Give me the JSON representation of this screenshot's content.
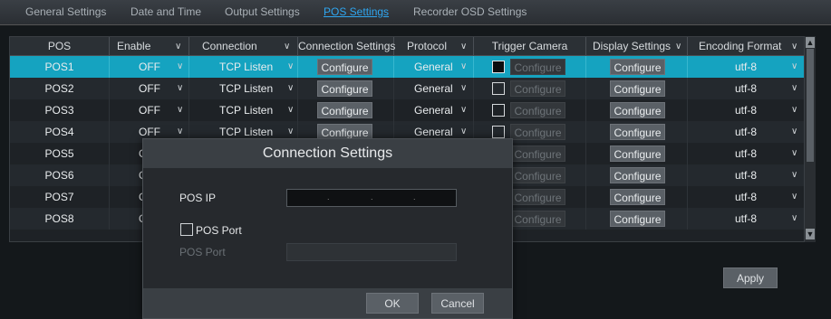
{
  "tabs": [
    {
      "label": "General Settings",
      "active": false
    },
    {
      "label": "Date and Time",
      "active": false
    },
    {
      "label": "Output Settings",
      "active": false
    },
    {
      "label": "POS Settings",
      "active": true
    },
    {
      "label": "Recorder OSD Settings",
      "active": false
    }
  ],
  "table": {
    "headers": [
      "POS",
      "Enable",
      "Connection",
      "Connection Settings",
      "Protocol",
      "Trigger Camera",
      "Display Settings",
      "Encoding Format"
    ],
    "rows": [
      {
        "pos": "POS1",
        "enable": "OFF",
        "connection": "TCP Listen",
        "conn_settings": "Configure",
        "protocol": "General",
        "trigger_checked": true,
        "trigger_btn": "Configure",
        "display_btn": "Configure",
        "encoding": "utf-8"
      },
      {
        "pos": "POS2",
        "enable": "OFF",
        "connection": "TCP Listen",
        "conn_settings": "Configure",
        "protocol": "General",
        "trigger_checked": false,
        "trigger_btn": "Configure",
        "display_btn": "Configure",
        "encoding": "utf-8"
      },
      {
        "pos": "POS3",
        "enable": "OFF",
        "connection": "TCP Listen",
        "conn_settings": "Configure",
        "protocol": "General",
        "trigger_checked": false,
        "trigger_btn": "Configure",
        "display_btn": "Configure",
        "encoding": "utf-8"
      },
      {
        "pos": "POS4",
        "enable": "OFF",
        "connection": "TCP Listen",
        "conn_settings": "Configure",
        "protocol": "General",
        "trigger_checked": false,
        "trigger_btn": "Configure",
        "display_btn": "Configure",
        "encoding": "utf-8"
      },
      {
        "pos": "POS5",
        "enable": "OF",
        "connection": "",
        "conn_settings": "",
        "protocol": "",
        "trigger_checked": false,
        "trigger_btn": "Configure",
        "display_btn": "Configure",
        "encoding": "utf-8"
      },
      {
        "pos": "POS6",
        "enable": "OF",
        "connection": "",
        "conn_settings": "",
        "protocol": "",
        "trigger_checked": false,
        "trigger_btn": "Configure",
        "display_btn": "Configure",
        "encoding": "utf-8"
      },
      {
        "pos": "POS7",
        "enable": "OF",
        "connection": "",
        "conn_settings": "",
        "protocol": "",
        "trigger_checked": false,
        "trigger_btn": "Configure",
        "display_btn": "Configure",
        "encoding": "utf-8"
      },
      {
        "pos": "POS8",
        "enable": "OF",
        "connection": "",
        "conn_settings": "",
        "protocol": "",
        "trigger_checked": false,
        "trigger_btn": "Configure",
        "display_btn": "Configure",
        "encoding": "utf-8"
      }
    ]
  },
  "apply_label": "Apply",
  "dialog": {
    "title": "Connection Settings",
    "pos_ip_label": "POS IP",
    "pos_port_checkbox_label": "POS Port",
    "pos_port_label": "POS Port",
    "ok_label": "OK",
    "cancel_label": "Cancel"
  },
  "colors": {
    "selected_row": "#15a3c0",
    "active_tab": "#2fa6f0"
  }
}
